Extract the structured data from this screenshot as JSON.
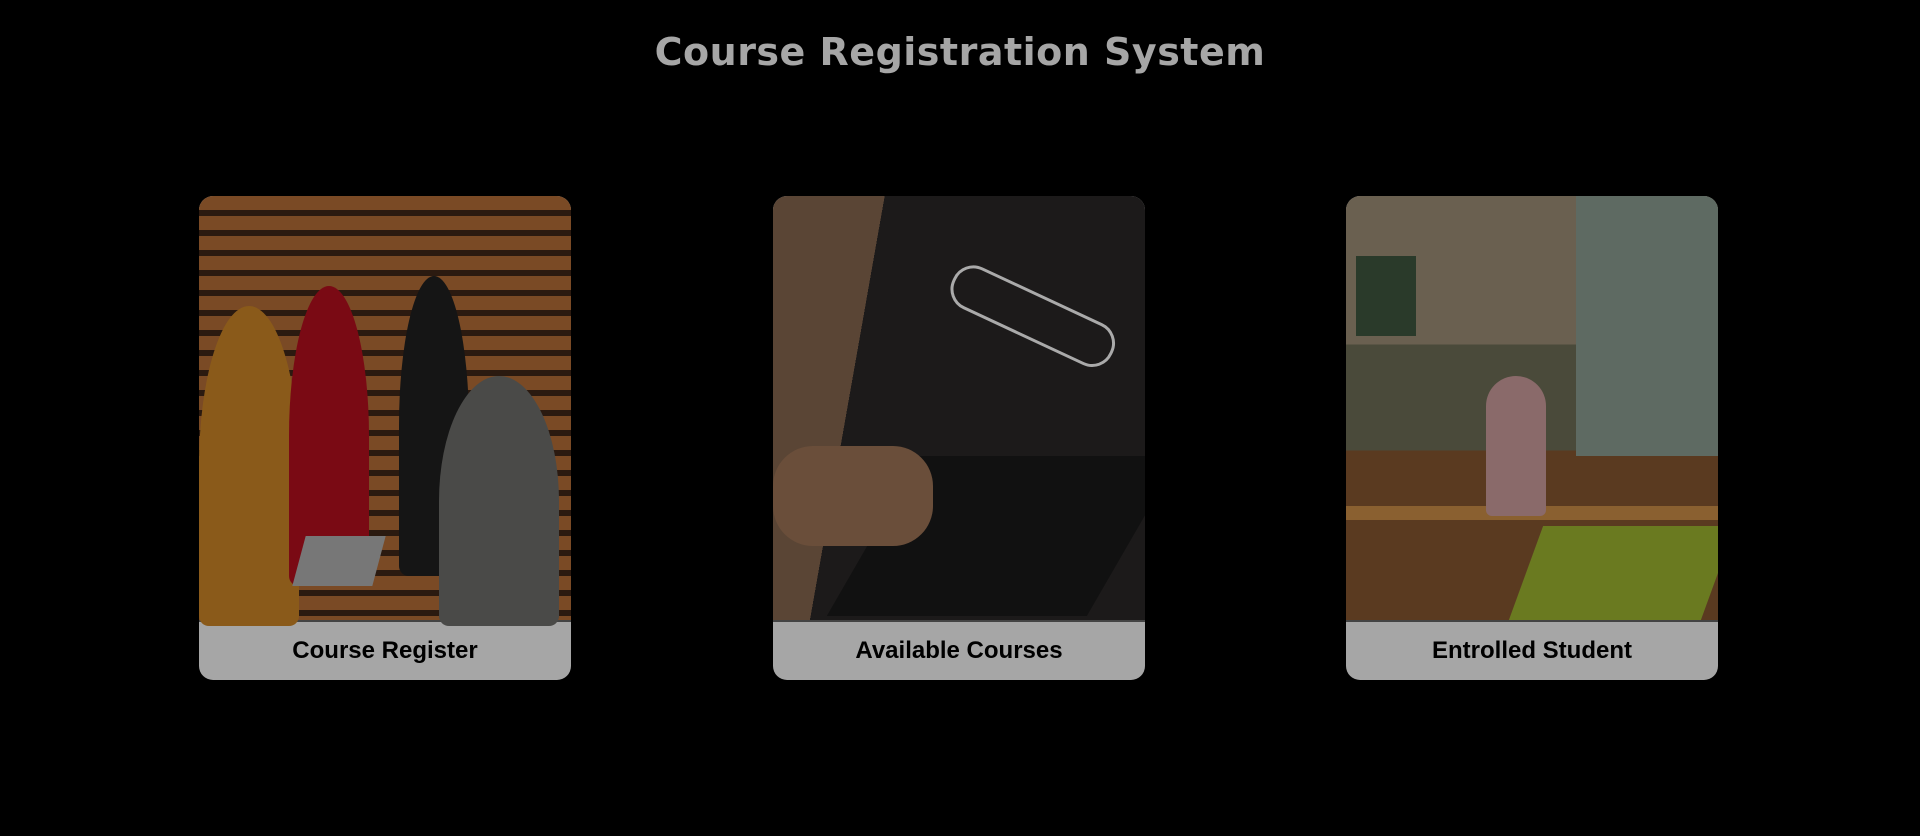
{
  "header": {
    "title": "Course Registration System"
  },
  "cards": [
    {
      "label": "Course Register",
      "image": "students-with-laptop-photo"
    },
    {
      "label": "Available Courses",
      "image": "laptop-search-photo"
    },
    {
      "label": "Entrolled Student",
      "image": "classroom-raised-hands-photo"
    }
  ]
}
